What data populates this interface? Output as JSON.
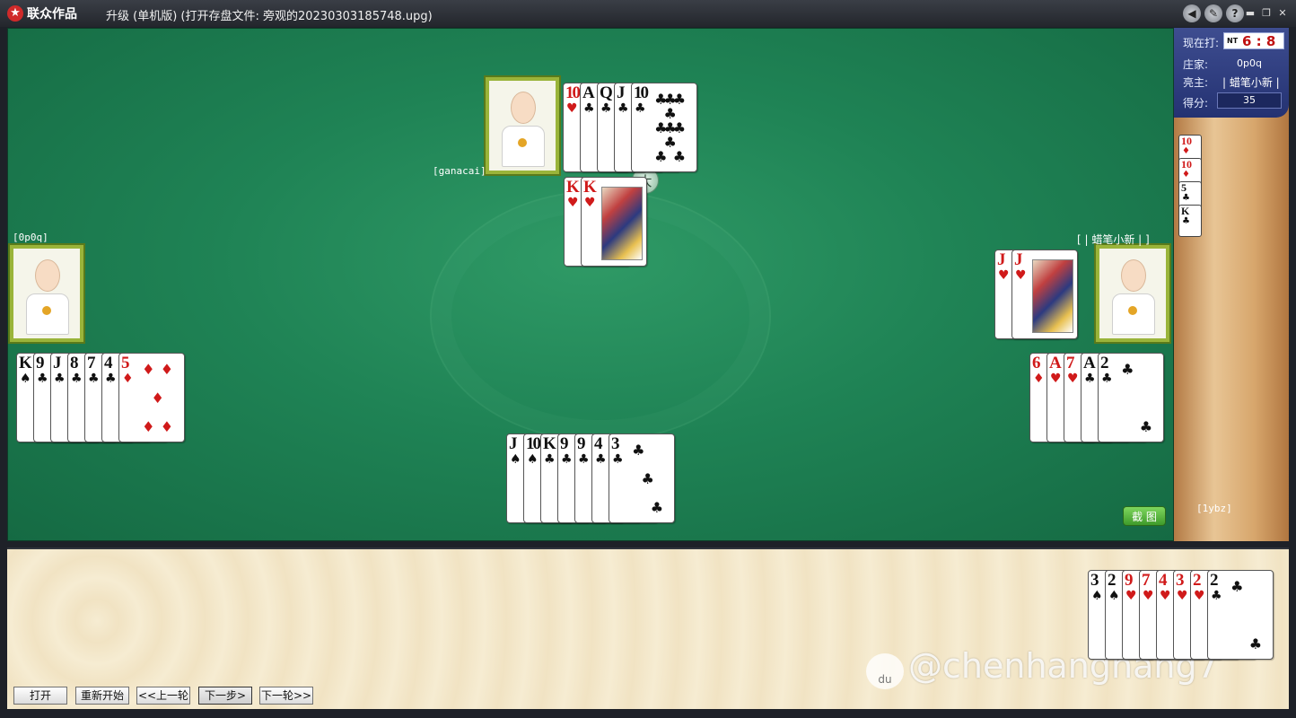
{
  "window": {
    "brand": "联众作品",
    "logo_icon": "★",
    "title": "升级 (单机版) (打开存盘文件: 旁观的20230303185748.upg)",
    "icons": [
      {
        "name": "sound-icon",
        "glyph": "◀"
      },
      {
        "name": "settings-icon",
        "glyph": "✎"
      },
      {
        "name": "help-icon",
        "glyph": "?"
      }
    ],
    "minimize": "▬",
    "restore": "❐",
    "close": "✕"
  },
  "players": {
    "north": {
      "name": "[ganacai]"
    },
    "west": {
      "name": "[0p0q]"
    },
    "east": {
      "name": "[ | 蜡笔小新 | ]"
    },
    "south": {
      "name": "[1ybz]"
    }
  },
  "hands": {
    "north_played": [
      {
        "rank": "10",
        "suit": "♥",
        "color": "red"
      },
      {
        "rank": "A",
        "suit": "♣",
        "color": "black"
      },
      {
        "rank": "Q",
        "suit": "♣",
        "color": "black"
      },
      {
        "rank": "J",
        "suit": "♣",
        "color": "black"
      },
      {
        "rank": "10",
        "suit": "♣",
        "color": "black"
      }
    ],
    "center_trick": [
      {
        "rank": "K",
        "suit": "♥",
        "color": "red"
      },
      {
        "rank": "K",
        "suit": "♥",
        "color": "red"
      }
    ],
    "west": [
      {
        "rank": "K",
        "suit": "♠",
        "color": "black"
      },
      {
        "rank": "9",
        "suit": "♣",
        "color": "black"
      },
      {
        "rank": "J",
        "suit": "♣",
        "color": "black"
      },
      {
        "rank": "8",
        "suit": "♣",
        "color": "black"
      },
      {
        "rank": "7",
        "suit": "♣",
        "color": "black"
      },
      {
        "rank": "4",
        "suit": "♣",
        "color": "black"
      },
      {
        "rank": "5",
        "suit": "♦",
        "color": "red"
      }
    ],
    "east_played": [
      {
        "rank": "J",
        "suit": "♥",
        "color": "red"
      },
      {
        "rank": "J",
        "suit": "♥",
        "color": "red"
      }
    ],
    "east": [
      {
        "rank": "6",
        "suit": "♦",
        "color": "red"
      },
      {
        "rank": "A",
        "suit": "♥",
        "color": "red"
      },
      {
        "rank": "7",
        "suit": "♥",
        "color": "red"
      },
      {
        "rank": "A",
        "suit": "♣",
        "color": "black"
      },
      {
        "rank": "2",
        "suit": "♣",
        "color": "black"
      }
    ],
    "south_played": [
      {
        "rank": "J",
        "suit": "♠",
        "color": "black"
      },
      {
        "rank": "10",
        "suit": "♠",
        "color": "black"
      },
      {
        "rank": "K",
        "suit": "♣",
        "color": "black"
      },
      {
        "rank": "9",
        "suit": "♣",
        "color": "black"
      },
      {
        "rank": "9",
        "suit": "♣",
        "color": "black"
      },
      {
        "rank": "4",
        "suit": "♣",
        "color": "black"
      },
      {
        "rank": "3",
        "suit": "♣",
        "color": "black"
      }
    ],
    "my_hand": [
      {
        "rank": "3",
        "suit": "♠",
        "color": "black"
      },
      {
        "rank": "2",
        "suit": "♠",
        "color": "black"
      },
      {
        "rank": "9",
        "suit": "♥",
        "color": "red"
      },
      {
        "rank": "7",
        "suit": "♥",
        "color": "red"
      },
      {
        "rank": "4",
        "suit": "♥",
        "color": "red"
      },
      {
        "rank": "3",
        "suit": "♥",
        "color": "red"
      },
      {
        "rank": "2",
        "suit": "♥",
        "color": "red"
      },
      {
        "rank": "2",
        "suit": "♣",
        "color": "black"
      }
    ],
    "score_cards": [
      {
        "rank": "10",
        "suit": "♦",
        "color": "red"
      },
      {
        "rank": "10",
        "suit": "♦",
        "color": "red"
      },
      {
        "rank": "5",
        "suit": "♣",
        "color": "black"
      },
      {
        "rank": "K",
        "suit": "♣",
        "color": "black"
      }
    ]
  },
  "big_marker": "大",
  "scoreboard": {
    "now_playing_label": "现在打:",
    "trump_label": "NT",
    "level": "6 : 8",
    "dealer_label": "庄家:",
    "dealer_value": "0p0q",
    "declarer_label": "亮主:",
    "declarer_value": "| 蜡笔小新 |",
    "score_label": "得分:",
    "score_value": "35"
  },
  "screenshot_button": "截 图",
  "controls": {
    "open": "打开",
    "restart": "重新开始",
    "prev": "<<上一轮",
    "next_step": "下一步>",
    "next_round": "下一轮>>"
  },
  "watermark": {
    "logo": "du",
    "text": "@chenhanghang7"
  },
  "colors": {
    "table_green": "#1f8355",
    "red_suit": "#d01a1a",
    "scoreboard_blue": "#243272"
  }
}
